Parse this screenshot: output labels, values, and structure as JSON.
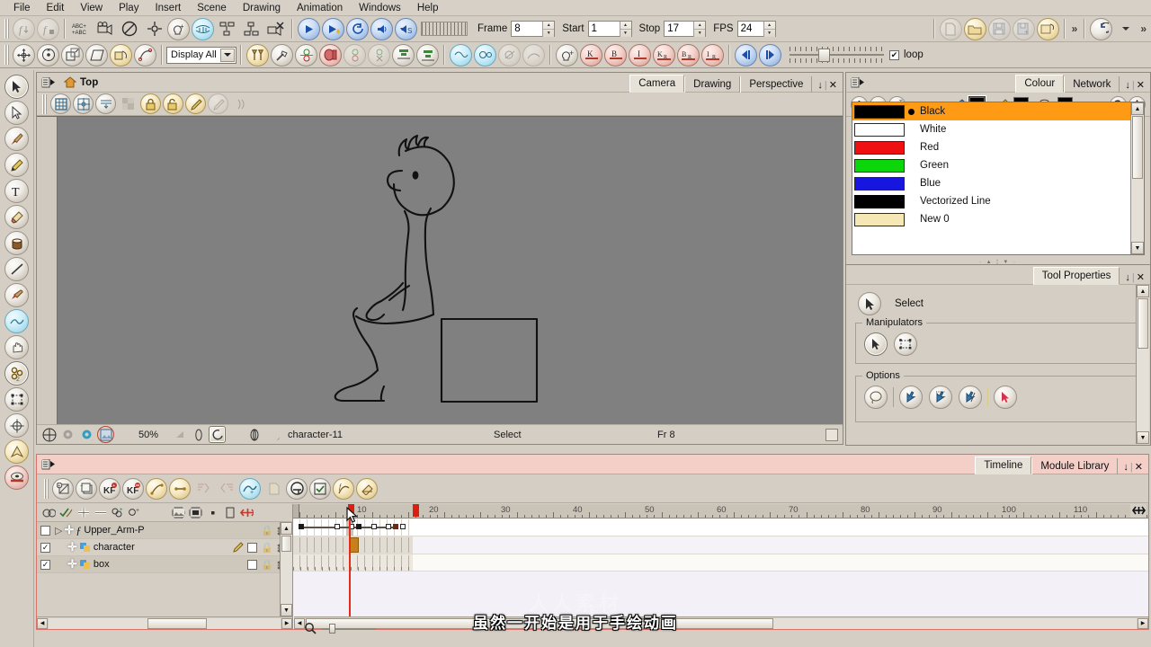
{
  "menu": {
    "items": [
      "File",
      "Edit",
      "View",
      "Play",
      "Insert",
      "Scene",
      "Drawing",
      "Animation",
      "Windows",
      "Help"
    ]
  },
  "toolbar_top": {
    "frame_label": "Frame",
    "frame_value": "8",
    "start_label": "Start",
    "start_value": "1",
    "stop_label": "Stop",
    "stop_value": "17",
    "fps_label": "FPS",
    "fps_value": "24",
    "loop_label": "loop",
    "loop_checked": "✔",
    "overflow_glyph": "»"
  },
  "toolbar_second": {
    "display_select": "Display All",
    "select_arrow": "▼"
  },
  "left_tools": [
    {
      "name": "select-tool",
      "glyph": "arrow"
    },
    {
      "name": "contour-editor-tool",
      "glyph": "arrow-outline"
    },
    {
      "name": "brush-tool",
      "glyph": "brush"
    },
    {
      "name": "pencil-tool",
      "glyph": "pencil"
    },
    {
      "name": "text-tool",
      "glyph": "T"
    },
    {
      "name": "eraser-tool",
      "glyph": "eraser"
    },
    {
      "name": "paint-bucket-tool",
      "glyph": "bucket"
    },
    {
      "name": "line-tool",
      "glyph": "line"
    },
    {
      "name": "dropper-tool",
      "glyph": "dropper"
    },
    {
      "name": "smooth-tool",
      "glyph": "smooth"
    },
    {
      "name": "hand-tool",
      "glyph": "hand"
    },
    {
      "name": "transform-tool",
      "glyph": "transform"
    },
    {
      "name": "deform-tool",
      "glyph": "deform"
    },
    {
      "name": "pivot-tool",
      "glyph": "pivot"
    },
    {
      "name": "cutter-tool",
      "glyph": "cutter"
    },
    {
      "name": "morph-tool",
      "glyph": "morph"
    }
  ],
  "camera_panel": {
    "view_name": "Top",
    "tabs": [
      "Camera",
      "Drawing",
      "Perspective"
    ],
    "active_tab": "Camera",
    "status": {
      "zoom": "50%",
      "drawing_name": "character-11",
      "tool": "Select",
      "frame": "Fr 8"
    }
  },
  "colour_panel": {
    "tabs": [
      "Colour",
      "Network"
    ],
    "active_tab": "Colour",
    "colours": [
      {
        "name": "Black",
        "hex": "#000000",
        "selected": true,
        "marked": true
      },
      {
        "name": "White",
        "hex": "#ffffff",
        "selected": false,
        "marked": false
      },
      {
        "name": "Red",
        "hex": "#ef1111",
        "selected": false,
        "marked": false
      },
      {
        "name": "Green",
        "hex": "#0ad60a",
        "selected": false,
        "marked": false
      },
      {
        "name": "Blue",
        "hex": "#1616e0",
        "selected": false,
        "marked": false
      },
      {
        "name": "Vectorized Line",
        "hex": "#000000",
        "selected": false,
        "marked": false
      },
      {
        "name": "New 0",
        "hex": "#f5e8b4",
        "selected": false,
        "marked": false
      }
    ],
    "selection_colour": "#ff9a15"
  },
  "tool_properties": {
    "tabs": [
      "Tool Properties"
    ],
    "tool_name": "Select",
    "groups": [
      {
        "label": "Manipulators"
      },
      {
        "label": "Options"
      }
    ]
  },
  "timeline_panel": {
    "tabs": [
      "Timeline",
      "Module Library"
    ],
    "active_tab": "Timeline",
    "layers": [
      {
        "name": "Upper_Arm-P",
        "checked": false,
        "type": "peg"
      },
      {
        "name": "character",
        "checked": true,
        "type": "drawing"
      },
      {
        "name": "box",
        "checked": true,
        "type": "drawing"
      }
    ],
    "ruler": {
      "ticks": [
        10,
        20,
        30,
        40,
        50,
        60,
        70,
        80,
        90,
        100,
        110
      ],
      "start_frame": 1,
      "stop_frame": 17,
      "current_frame": 8
    },
    "keyframes": [
      1,
      6,
      8,
      9,
      11,
      13,
      14
    ],
    "exposure_highlight_frame": 8
  },
  "subtitle": {
    "text": "虽然一开始是用于手绘动画",
    "watermark": "人人素材"
  }
}
